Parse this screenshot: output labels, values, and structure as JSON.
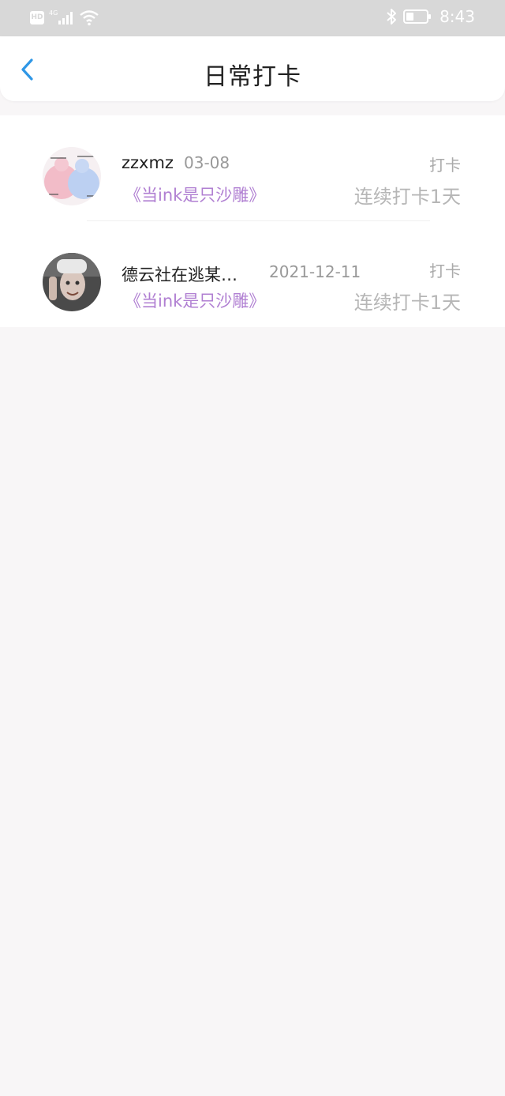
{
  "status_bar": {
    "hd_label": "HD",
    "network_label": "4G",
    "time": "8:43",
    "icons": [
      "hd-icon",
      "signal-icon",
      "wifi-icon",
      "bluetooth-icon",
      "battery-icon"
    ]
  },
  "header": {
    "title": "日常打卡",
    "back_icon": "chevron-left-icon",
    "accent_color": "#2f97e6"
  },
  "checkins": [
    {
      "name": "zzxmz",
      "date": "03-08",
      "tag": "打卡",
      "group": "《当ink是只沙雕》",
      "streak": "连续打卡1天",
      "avatar": "avatar-image"
    },
    {
      "name": "德云社在逃某…",
      "date": "2021-12-11",
      "tag": "打卡",
      "group": "《当ink是只沙雕》",
      "streak": "连续打卡1天",
      "avatar": "avatar-image"
    }
  ],
  "colors": {
    "group_link": "#b07fd2",
    "status_bar": "#d8d8d8",
    "background": "#f8f6f7"
  }
}
